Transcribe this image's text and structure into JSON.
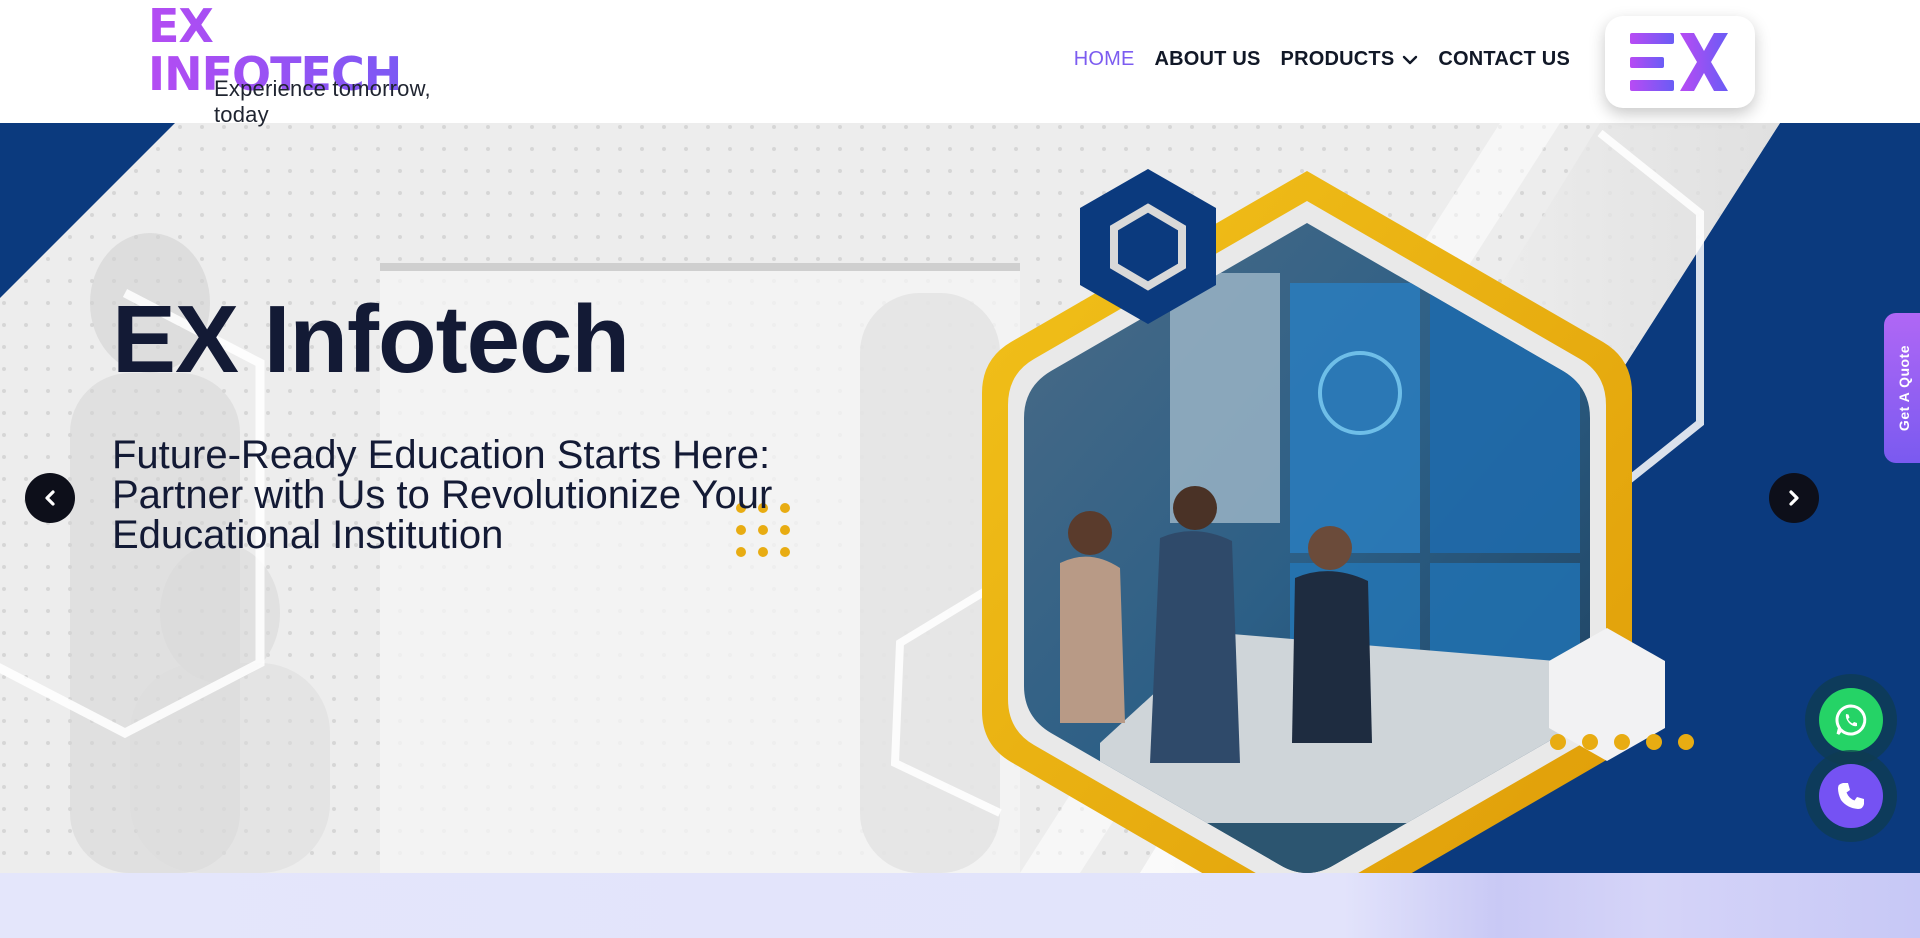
{
  "header": {
    "logo_text": "EX INFOTECH",
    "tagline": "Experience tomorrow, today",
    "nav": [
      {
        "label": "HOME",
        "active": true
      },
      {
        "label": "ABOUT US",
        "active": false
      },
      {
        "label": "PRODUCTS",
        "active": false,
        "has_dropdown": true
      },
      {
        "label": "CONTACT US",
        "active": false
      }
    ],
    "badge_icon": "ex-logo-icon"
  },
  "hero": {
    "title": "EX Infotech",
    "subtitle": "Future-Ready Education Starts Here: Partner with Us to Revolutionize Your Educational Institution",
    "prev_icon": "chevron-left-icon",
    "next_icon": "chevron-right-icon",
    "slide_count": 5
  },
  "floating": {
    "quote_label": "Get A Quote",
    "whatsapp_icon": "whatsapp-icon",
    "phone_icon": "phone-icon"
  },
  "colors": {
    "accent": "#7c5cf0",
    "navy": "#0b3a7e",
    "gold": "#e8ac12",
    "title": "#131a35"
  }
}
